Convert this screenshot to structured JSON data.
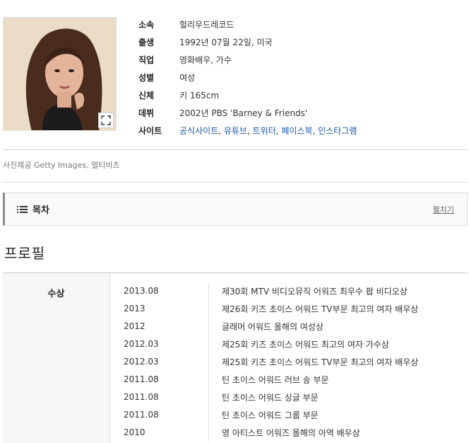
{
  "profile": {
    "rows": [
      {
        "label": "소속",
        "value": "헐리우드레코드"
      },
      {
        "label": "출생",
        "value": "1992년 07월 22일, 미국"
      },
      {
        "label": "직업",
        "value": "영화배우, 가수"
      },
      {
        "label": "성별",
        "value": "여성"
      },
      {
        "label": "신체",
        "value": "키 165cm"
      },
      {
        "label": "데뷔",
        "value": "2002년 PBS 'Barney & Friends'"
      }
    ],
    "site_label": "사이트",
    "sites": [
      "공식사이트",
      "유튜브",
      "트위터",
      "페이스북",
      "인스타그램"
    ]
  },
  "photo_credit": "사진제공  Getty Images, 멀티비츠",
  "toc": {
    "title": "목차",
    "toggle": "펼치기"
  },
  "section_title": "프로필",
  "awards": {
    "label": "수상",
    "rows": [
      {
        "date": "2013.08",
        "name": "제30회 MTV 비디오뮤직 어워즈 최우수 팝 비디오상"
      },
      {
        "date": "2013",
        "name": "제26회 키즈 초이스 어워드 TV부문 최고의 여자 배우상"
      },
      {
        "date": "2012",
        "name": "글래머 어워드 올해의 여성상"
      },
      {
        "date": "2012.03",
        "name": "제25회 키즈 초이스 어워드 최고의 여자 가수상"
      },
      {
        "date": "2012.03",
        "name": "제25회 키즈 초이스 어워드 TV부문 최고의 여자 배우상"
      },
      {
        "date": "2011.08",
        "name": "틴 초이스 어워드 러브 송 부문"
      },
      {
        "date": "2011.08",
        "name": "틴 초이스 어워드 싱글 부문"
      },
      {
        "date": "2011.08",
        "name": "틴 초이스 어워드 그룹 부문"
      },
      {
        "date": "2010",
        "name": "영 아티스트 어워즈 올해의 아역 배우상"
      }
    ]
  },
  "icons": {
    "expand": "expand-icon",
    "toc": "list-icon"
  }
}
